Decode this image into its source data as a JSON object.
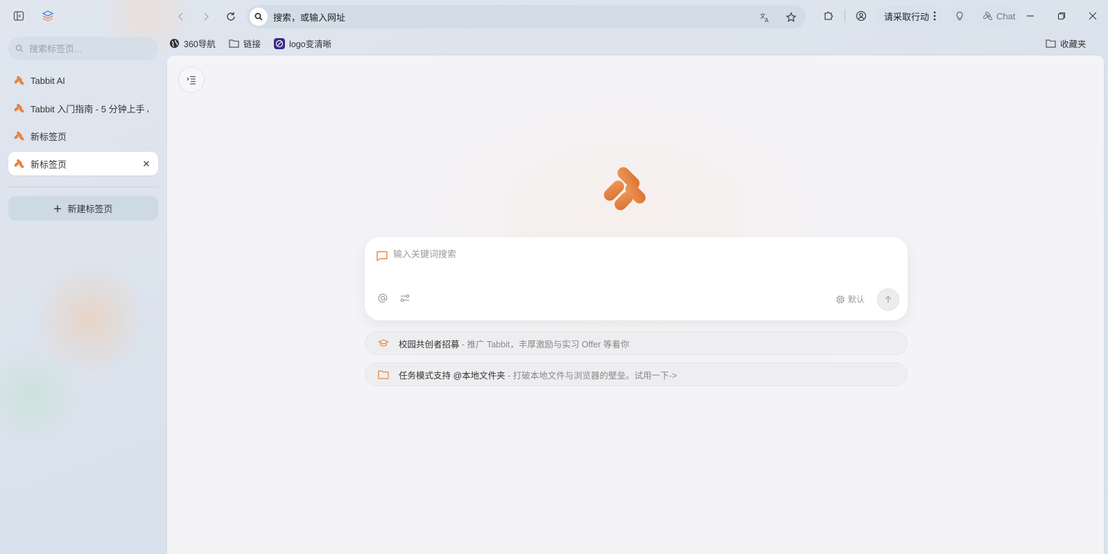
{
  "sidebar": {
    "search_placeholder": "搜索标签页...",
    "tabs": [
      {
        "label": "Tabbit AI",
        "active": false
      },
      {
        "label": "Tabbit 入门指南 - 5 分钟上手 A",
        "active": false
      },
      {
        "label": "新标签页",
        "active": false
      },
      {
        "label": "新标签页",
        "active": true
      }
    ],
    "new_tab_label": "新建标签页"
  },
  "topbar": {
    "url_text": "搜索，或输入网址",
    "action_label": "请采取行动",
    "chat_label": "Chat"
  },
  "bookmarks": [
    {
      "label": "360导航",
      "icon": "globe-icon"
    },
    {
      "label": "链接",
      "icon": "folder-icon"
    },
    {
      "label": "logo变清晰",
      "icon": "app-icon"
    }
  ],
  "bookmarks_folder": {
    "label": "收藏夹",
    "icon": "folder-icon"
  },
  "main": {
    "search_placeholder": "输入关键词搜索",
    "model_label": "默认",
    "suggestions": [
      {
        "title": "校园共创者招募",
        "desc": " - 推广 Tabbit，丰厚激励与实习 Offer 等着你",
        "icon": "graduation-cap-icon"
      },
      {
        "title": "任务模式支持 @本地文件夹",
        "desc": " - 打破本地文件与浏览器的壁垒。试用一下->",
        "icon": "folder-icon"
      }
    ]
  },
  "colors": {
    "accent": "#e8843f",
    "logo": "#e07a36"
  }
}
